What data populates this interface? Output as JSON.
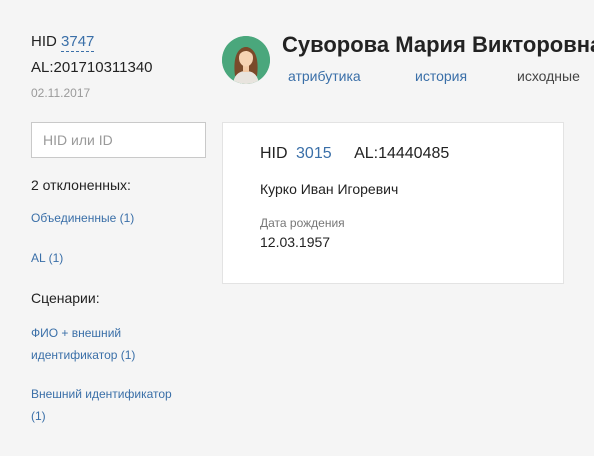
{
  "left": {
    "hid_label": "HID",
    "hid_number": "3747",
    "al_id": "AL:201710311340",
    "date": "02.11.2017",
    "search_placeholder": "HID или ID",
    "rejected_title": "2 отклоненных:",
    "merged_link": "Объединенные (1)",
    "al_link": "AL (1)",
    "scenarios_title": "Сценарии:",
    "scenario_1": "ФИО + внешний идентификатор (1)",
    "scenario_2": "Внешний идентификатор (1)"
  },
  "header": {
    "name": "Суворова Мария Викторовна",
    "tabs": [
      "атрибутика",
      "история",
      "исходные"
    ]
  },
  "card": {
    "hid_label": "HID",
    "hid_number": "3015",
    "al_id": "AL:14440485",
    "person": "Курко Иван Игоревич",
    "dob_label": "Дата рождения",
    "dob": "12.03.1957"
  },
  "colors": {
    "link": "#3a6fa8",
    "avatar_bg": "#4aa77c",
    "background": "#f5f5f5"
  }
}
